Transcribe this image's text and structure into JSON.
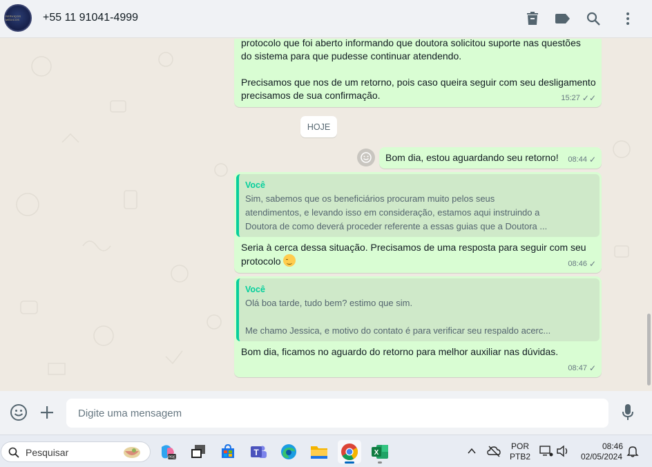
{
  "header": {
    "avatar_text": "SERVIÇOS MÉDICOS",
    "contact_name": "+55 11 91041-4999",
    "icons": [
      "delete-icon",
      "label-icon",
      "search-icon",
      "menu-icon"
    ]
  },
  "messages": {
    "m1": {
      "line1": "protocolo que foi aberto informando que doutora solicitou suporte nas questões",
      "line2": "do sistema para que pudesse continuar atendendo.",
      "line3": "Precisamos que nos de um retorno, pois caso queira seguir com seu desligamento",
      "line4": "precisamos de sua confirmação.",
      "time": "15:27",
      "ticks": "✓✓"
    },
    "day_chip": "HOJE",
    "m2": {
      "text": "Bom dia, estou aguardando seu retorno!",
      "time": "08:44",
      "ticks": "✓"
    },
    "m3": {
      "quote_author": "Você",
      "quote_line1": "Sim, sabemos que os beneficiários procuram muito pelos seus",
      "quote_line2": "atendimentos, e levando isso em consideração, estamos aqui instruindo a",
      "quote_line3": "Doutora de como deverá proceder referente a essas guias que a Doutora ...",
      "line1": "Seria à cerca dessa situação. Precisamos de uma resposta para seguir com seu",
      "line2": "protocolo",
      "time": "08:46",
      "ticks": "✓"
    },
    "m4": {
      "quote_author": "Você",
      "quote_line1": "Olá boa tarde, tudo bem? estimo que sim.",
      "quote_line2": "Me chamo Jessica, e motivo do contato é para verificar seu respaldo acerc...",
      "text": "Bom dia, ficamos no aguardo do retorno para melhor auxiliar nas dúvidas.",
      "time": "08:47",
      "ticks": "✓"
    }
  },
  "composer": {
    "placeholder": "Digite uma mensagem"
  },
  "taskbar": {
    "search_label": "Pesquisar",
    "apps": [
      "copilot-icon",
      "task-view-icon",
      "store-icon",
      "teams-icon",
      "edge-icon",
      "file-explorer-icon",
      "chrome-icon",
      "excel-icon"
    ],
    "language_line1": "POR",
    "language_line2": "PTB2",
    "clock_time": "08:46",
    "clock_date": "02/05/2024"
  }
}
